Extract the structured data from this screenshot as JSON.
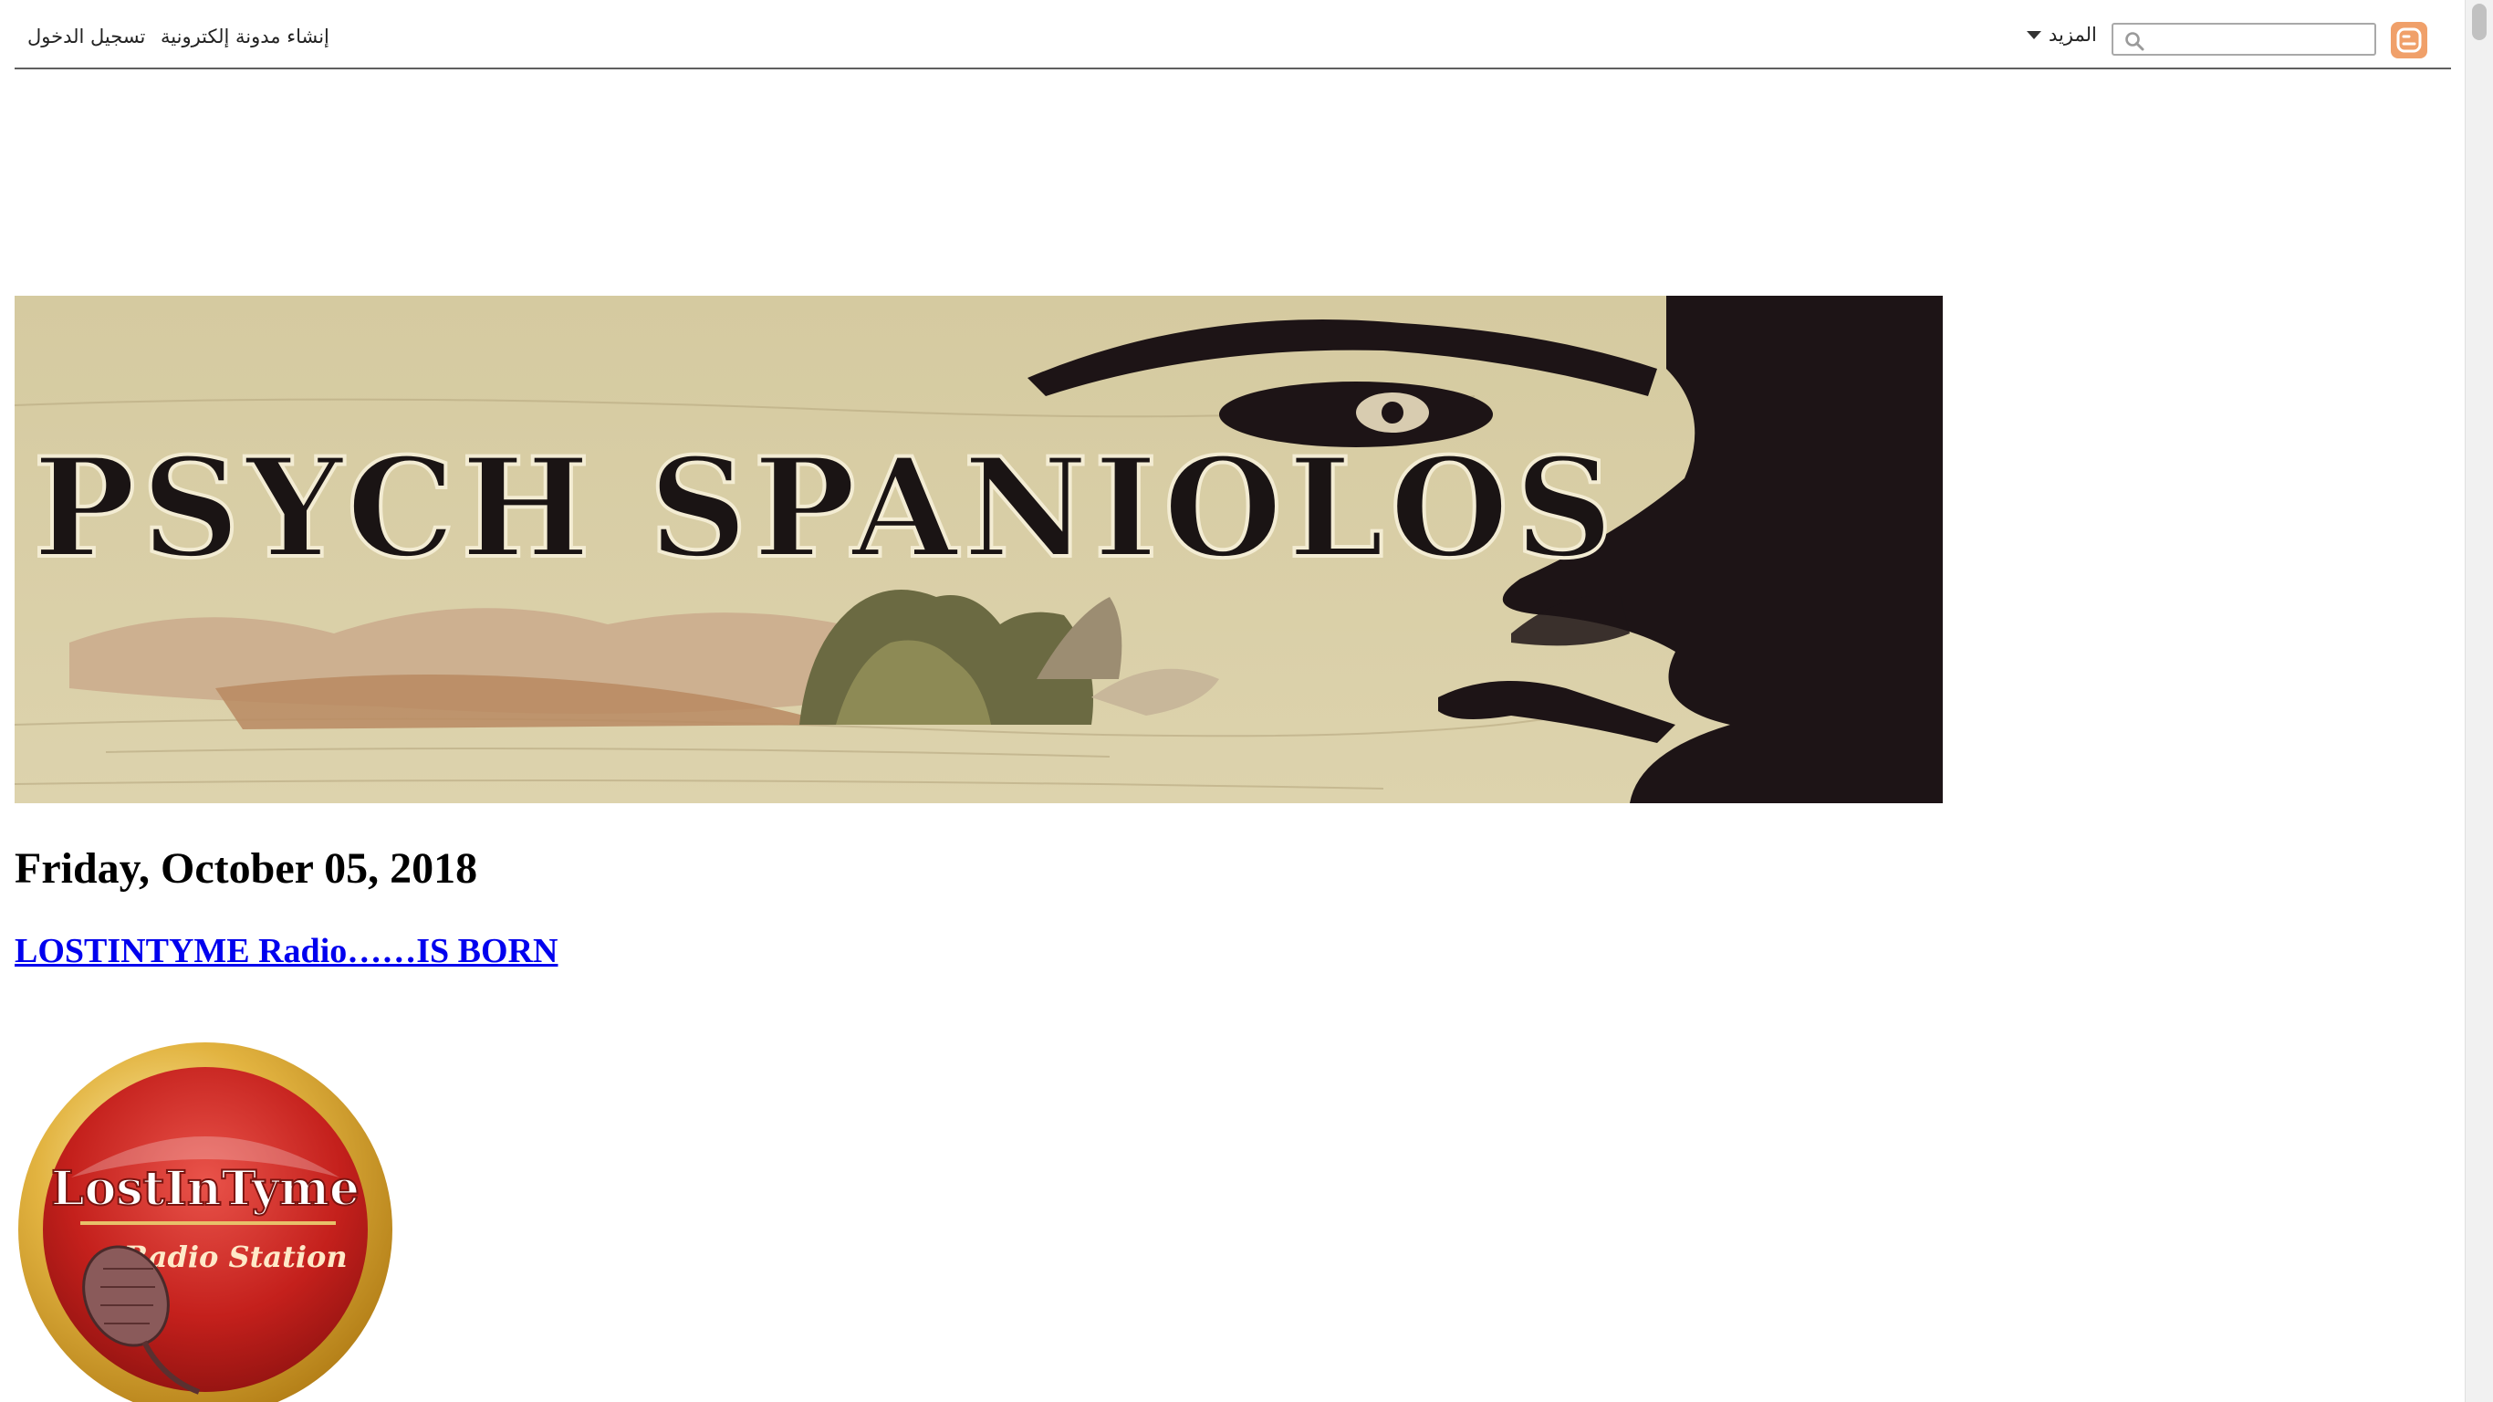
{
  "navbar": {
    "login_label": "تسجيل الدخول",
    "create_blog_label": "إنشاء مدونة إلكترونية",
    "more_label": "المزيد",
    "search_placeholder": "",
    "logo_icon": "blogger-icon",
    "search_icon": "search-icon"
  },
  "header": {
    "banner_text": "PSYCH SPANIOLOS"
  },
  "post": {
    "date": "Friday, October 05, 2018",
    "title": "LOSTINTYME Radio……IS BORN",
    "logo_top": "LostInTyme",
    "logo_bottom": "Radio Station"
  },
  "colors": {
    "link": "#0000ee",
    "banner_bg": "#d9cfa0",
    "logo_red": "#c4201c",
    "logo_gold": "#d9a430"
  }
}
